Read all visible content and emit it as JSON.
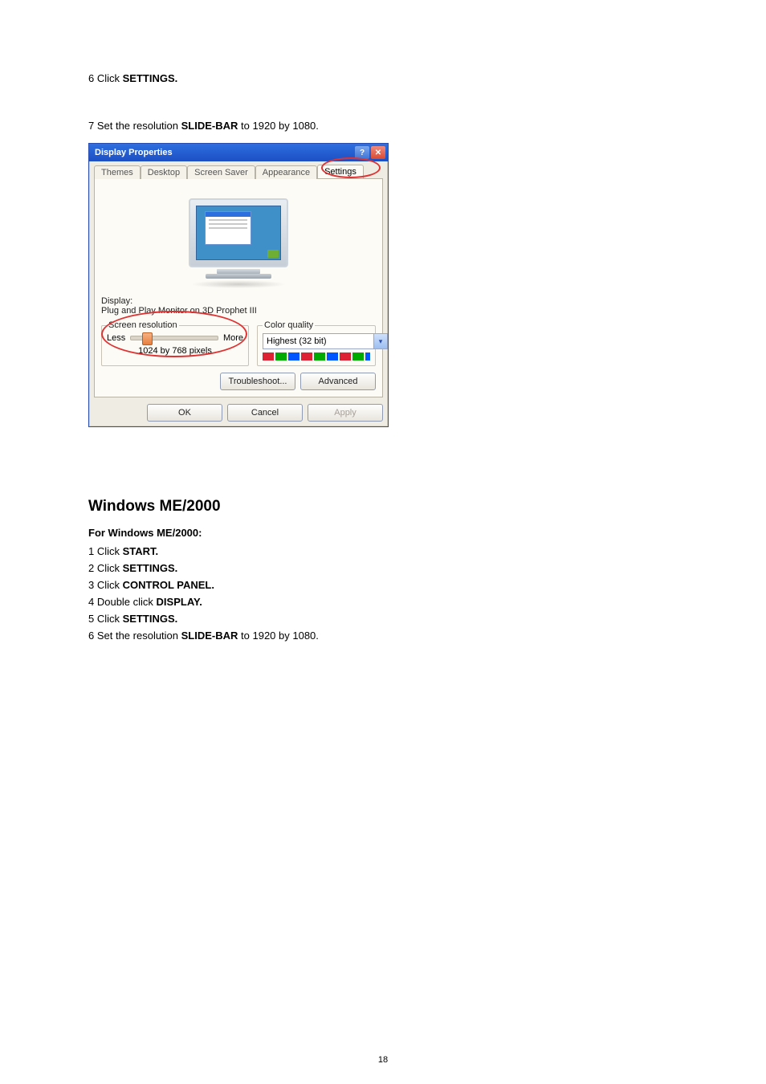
{
  "instructions_top": {
    "step6_prefix": "6 Click ",
    "step6_bold": "SETTINGS.",
    "step7_prefix": "7 Set the resolution ",
    "step7_bold": "SLIDE-BAR",
    "step7_suffix": " to 1920 by 1080."
  },
  "dialog": {
    "title": "Display Properties",
    "help_glyph": "?",
    "close_glyph": "✕",
    "tabs": {
      "themes": "Themes",
      "desktop": "Desktop",
      "screensaver": "Screen Saver",
      "appearance": "Appearance",
      "settings": "Settings"
    },
    "display_label": "Display:",
    "display_value": "Plug and Play Monitor on 3D Prophet III",
    "screen_resolution": {
      "legend": "Screen resolution",
      "less": "Less",
      "more": "More",
      "value": "1024 by 768 pixels"
    },
    "color_quality": {
      "legend": "Color quality",
      "selected": "Highest (32 bit)"
    },
    "buttons": {
      "troubleshoot": "Troubleshoot...",
      "advanced": "Advanced",
      "ok": "OK",
      "cancel": "Cancel",
      "apply": "Apply"
    }
  },
  "section_heading": "Windows ME/2000",
  "section_subhead": "For Windows ME/2000:",
  "steps": {
    "s1_pre": "1 Click ",
    "s1_bold": "START.",
    "s2_pre": "2 Click ",
    "s2_bold": "SETTINGS.",
    "s3_pre": "3 Click ",
    "s3_bold": "CONTROL PANEL.",
    "s4_pre": "4 Double click ",
    "s4_bold": "DISPLAY.",
    "s5_pre": "5 Click ",
    "s5_bold": "SETTINGS.",
    "s6_pre": "6 Set the resolution ",
    "s6_bold": "SLIDE-BAR",
    "s6_suf": " to 1920 by 1080."
  },
  "page_number": "18"
}
